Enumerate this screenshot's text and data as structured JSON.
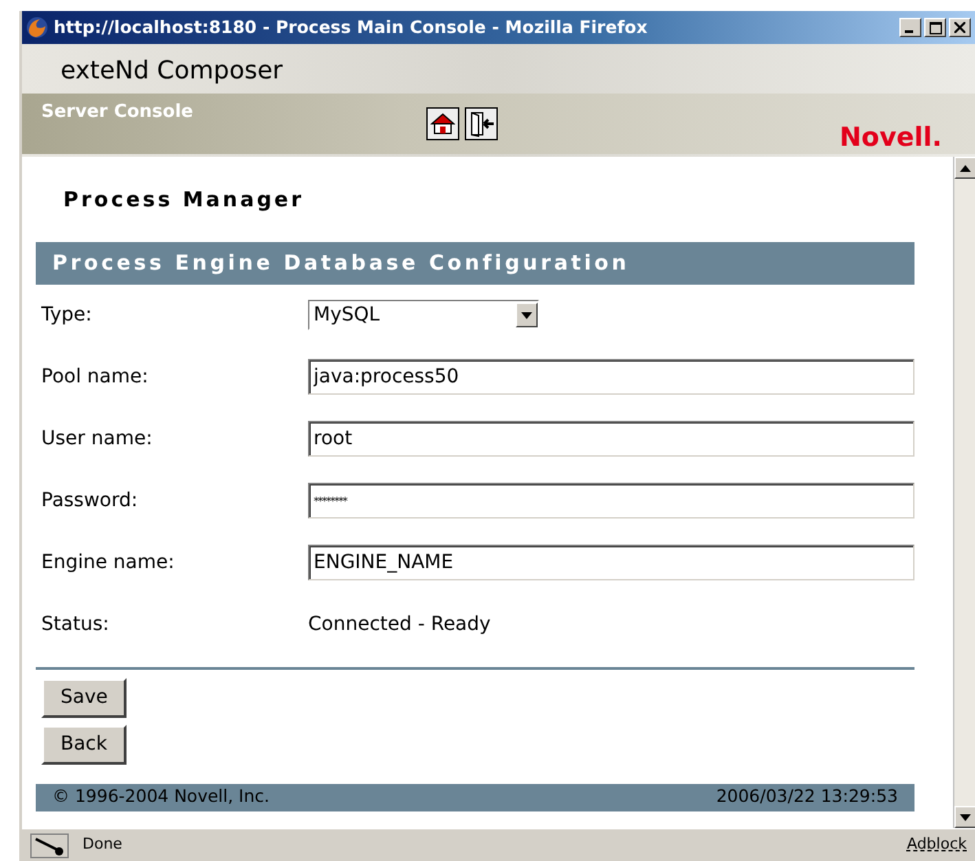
{
  "window": {
    "title": "http://localhost:8180 - Process Main Console - Mozilla Firefox"
  },
  "header": {
    "product": "exteNd Composer",
    "subtitle": "Server Console",
    "brand": "Novell."
  },
  "page_title": "Process Manager",
  "section_title": "Process Engine Database Configuration",
  "fields": [
    {
      "kind": "select",
      "label": "Type:",
      "value": "MySQL"
    },
    {
      "kind": "text",
      "label": "Pool name:",
      "value": "java:process50"
    },
    {
      "kind": "text",
      "label": "User name:",
      "value": "root"
    },
    {
      "kind": "password",
      "label": "Password:",
      "value": "********"
    },
    {
      "kind": "text",
      "label": "Engine name:",
      "value": "ENGINE_NAME"
    },
    {
      "kind": "static",
      "label": "Status:",
      "value": "Connected - Ready"
    }
  ],
  "buttons": [
    "Save",
    "Back"
  ],
  "footer": {
    "copyright": "© 1996-2004 Novell, Inc.",
    "timestamp": "2006/03/22 13:29:53"
  },
  "status_bar": {
    "text": "Done",
    "addon": "Adblock"
  }
}
